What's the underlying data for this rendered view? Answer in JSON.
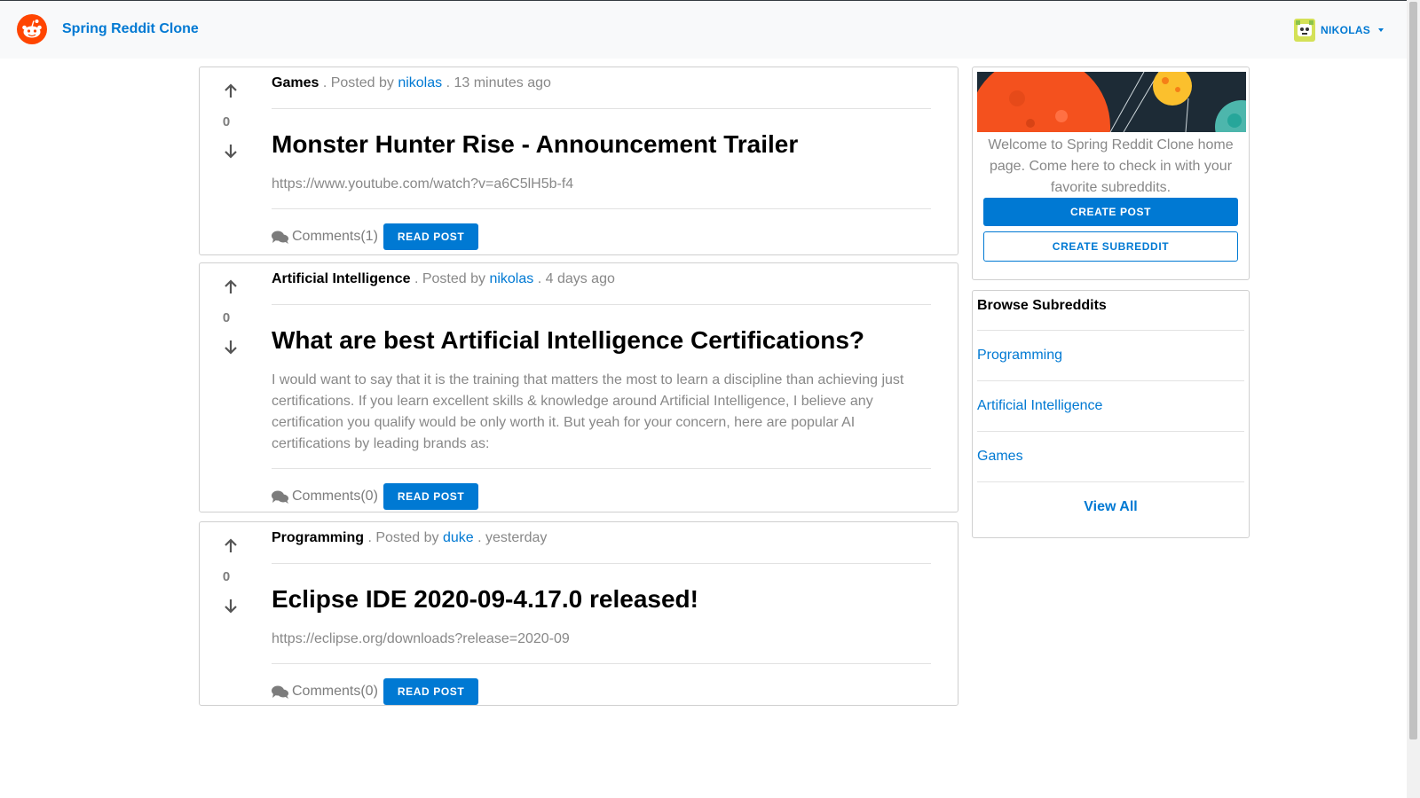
{
  "header": {
    "brand_name": "Spring Reddit Clone",
    "username": "NIKOLAS",
    "logo_icon": "reddit-alien-icon",
    "avatar_icon": "user-avatar-icon",
    "accent_color": "#0079d3",
    "logo_color": "#ff4500"
  },
  "posts": [
    {
      "subreddit": "Games",
      "posted_by_label": ". Posted by",
      "author": "nikolas",
      "time": ". 13 minutes ago",
      "votes": "0",
      "title": "Monster Hunter Rise - Announcement Trailer",
      "content": "https://www.youtube.com/watch?v=a6C5lH5b-f4",
      "comments": "Comments(1)",
      "read_label": "READ POST"
    },
    {
      "subreddit": "Artificial Intelligence",
      "posted_by_label": ". Posted by",
      "author": "nikolas",
      "time": ". 4 days ago",
      "votes": "0",
      "title": "What are best Artificial Intelligence Certifications?",
      "content": "I would want to say that it is the training that matters the most to learn a discipline than achieving just certifications. If you learn excellent skills & knowledge around Artificial Intelligence, I believe any certification you qualify would be only worth it. But yeah for your concern, here are popular AI certifications by leading brands as:",
      "comments": "Comments(0)",
      "read_label": "READ POST"
    },
    {
      "subreddit": "Programming",
      "posted_by_label": ". Posted by",
      "author": "duke",
      "time": ". yesterday",
      "votes": "0",
      "title": "Eclipse IDE 2020-09-4.17.0 released!",
      "content": "https://eclipse.org/downloads?release=2020-09",
      "comments": "Comments(0)",
      "read_label": "READ POST"
    }
  ],
  "sidebar": {
    "welcome_text": "Welcome to Spring Reddit Clone home page. Come here to check in with your favorite subreddits.",
    "create_post_label": "CREATE POST",
    "create_subreddit_label": "CREATE SUBREDDIT",
    "browse_title": "Browse Subreddits",
    "subreddits": [
      "Programming",
      "Artificial Intelligence",
      "Games"
    ],
    "view_all_label": "View All"
  }
}
